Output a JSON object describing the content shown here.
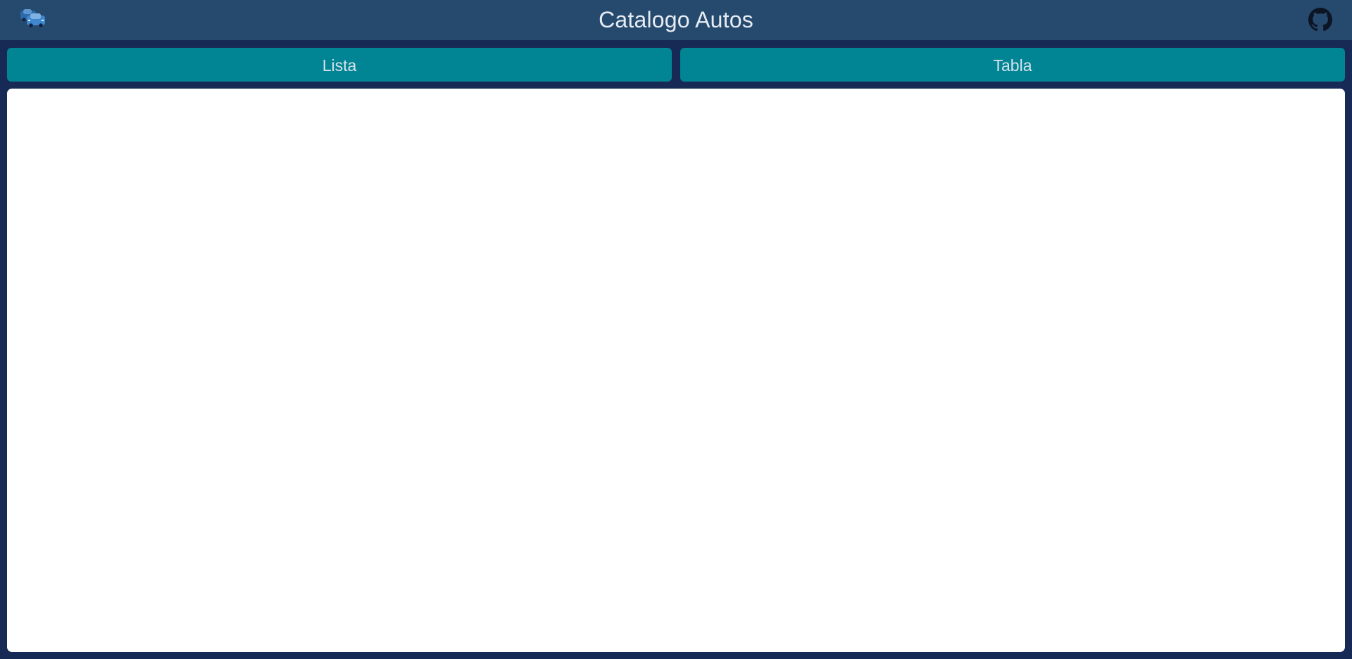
{
  "header": {
    "title": "Catalogo Autos",
    "logo_icon": "cars-icon",
    "repo_icon": "github-icon"
  },
  "nav": {
    "lista_label": "Lista",
    "tabla_label": "Tabla"
  },
  "colors": {
    "background": "#172a55",
    "header": "#264a6e",
    "button": "#018594",
    "content": "#ffffff"
  }
}
